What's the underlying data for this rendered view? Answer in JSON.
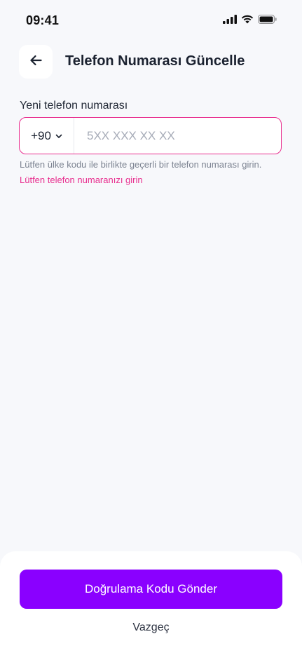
{
  "status_bar": {
    "time": "09:41",
    "icons": [
      "cellular-signal-icon",
      "wifi-icon",
      "battery-icon"
    ]
  },
  "header": {
    "back_icon": "arrow-left-icon",
    "title": "Telefon Numarası Güncelle"
  },
  "form": {
    "label": "Yeni telefon numarası",
    "country_code": "+90",
    "country_code_icon": "chevron-down-icon",
    "phone_value": "",
    "phone_placeholder": "5XX XXX XX XX",
    "helper": "Lütfen ülke kodu ile birlikte geçerli bir telefon numarası girin.",
    "error": "Lütfen telefon numaranızı girin"
  },
  "actions": {
    "primary_label": "Doğrulama Kodu Gönder",
    "secondary_label": "Vazgeç"
  },
  "colors": {
    "accent": "#8A00FF",
    "error": "#E8308F",
    "background": "#F7F8FB"
  }
}
